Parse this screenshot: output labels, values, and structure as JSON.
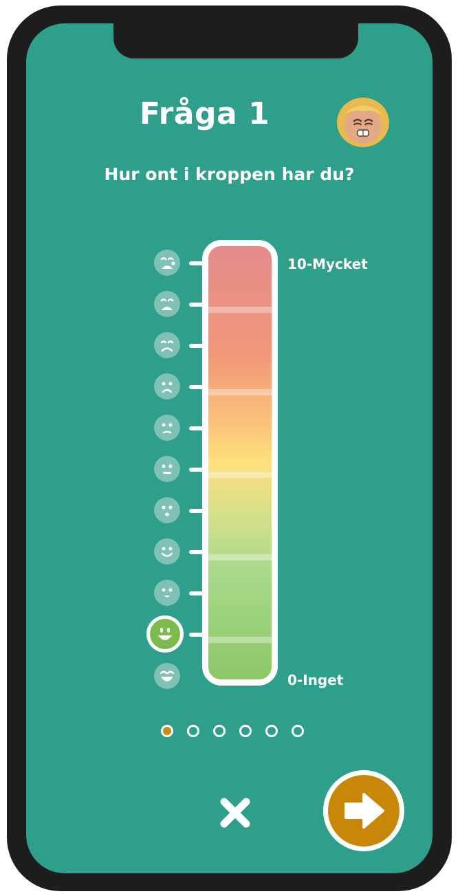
{
  "header": {
    "title": "Fråga 1",
    "question": "Hur ont i kroppen har du?"
  },
  "scale": {
    "top_label": "10-Mycket",
    "bottom_label": "0-Inget",
    "min": 0,
    "max": 10,
    "selected_value": 1,
    "face_icons": [
      "face-crying-icon",
      "face-very-sad-icon",
      "face-sad-icon",
      "face-worried-icon",
      "face-slightly-sad-icon",
      "face-neutral-icon",
      "face-slightly-neutral-icon",
      "face-smiling-icon",
      "face-happy-icon",
      "face-grinning-icon",
      "face-laughing-icon"
    ]
  },
  "pagination": {
    "total": 6,
    "current": 1
  },
  "actions": {
    "close_icon": "close-icon",
    "next_icon": "arrow-right-icon"
  },
  "colors": {
    "background": "#2e9f8b",
    "accent": "#c98708",
    "selected_face": "#7cba4d",
    "inactive_face": "#7fc1b4"
  }
}
